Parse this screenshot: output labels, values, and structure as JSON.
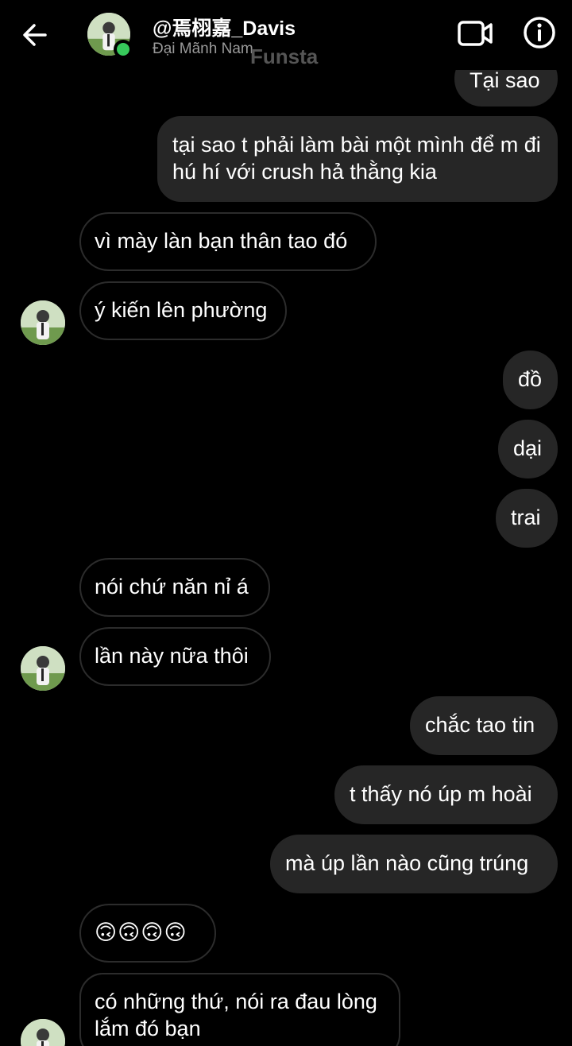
{
  "header": {
    "username": "@焉栩嘉_Davis",
    "subtitle": "Đại Mãnh Nam",
    "watermark": "Funsta",
    "icons": [
      "back-arrow-icon",
      "video-call-icon",
      "info-icon"
    ]
  },
  "colors": {
    "background": "#000000",
    "outgoing_bubble": "#262626",
    "incoming_border": "#2c2c2c",
    "online": "#37c95b"
  },
  "messages": [
    {
      "dir": "out",
      "text": "Tại sao"
    },
    {
      "dir": "out",
      "text": "tại sao t phải làm bài một mình để m đi hú hí với crush hả thằng kia"
    },
    {
      "dir": "in",
      "text": "vì mày làn bạn thân tao đó"
    },
    {
      "dir": "in",
      "text": "ý kiến lên phường"
    },
    {
      "dir": "out",
      "text": "đồ"
    },
    {
      "dir": "out",
      "text": "dại"
    },
    {
      "dir": "out",
      "text": "trai"
    },
    {
      "dir": "in",
      "text": "nói chứ năn nỉ á"
    },
    {
      "dir": "in",
      "text": "lần này nữa thôi"
    },
    {
      "dir": "out",
      "text": "chắc tao tin"
    },
    {
      "dir": "out",
      "text": "t thấy nó úp m hoài"
    },
    {
      "dir": "out",
      "text": "mà úp lần nào cũng trúng"
    },
    {
      "dir": "in",
      "text": "🙃🙃🙃🙃"
    },
    {
      "dir": "in",
      "text": "có những thứ, nói ra đau lòng lắm đó bạn"
    }
  ]
}
